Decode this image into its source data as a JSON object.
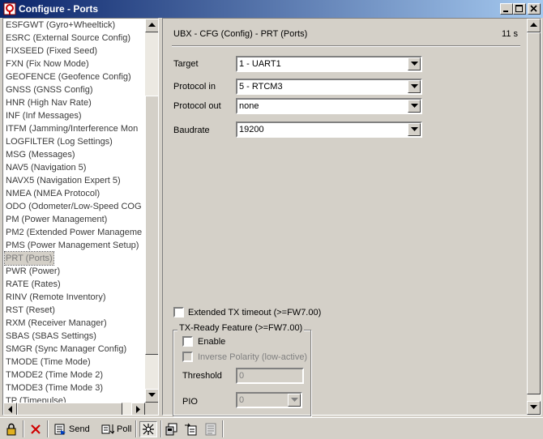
{
  "window": {
    "title": "Configure - Ports"
  },
  "list": {
    "items": [
      "ESFGWT (Gyro+Wheeltick)",
      "ESRC (External Source Config)",
      "FIXSEED (Fixed Seed)",
      "FXN (Fix Now Mode)",
      "GEOFENCE (Geofence Config)",
      "GNSS (GNSS Config)",
      "HNR (High Nav Rate)",
      "INF (Inf Messages)",
      "ITFM (Jamming/Interference Mon",
      "LOGFILTER (Log Settings)",
      "MSG (Messages)",
      "NAV5 (Navigation 5)",
      "NAVX5 (Navigation Expert 5)",
      "NMEA (NMEA Protocol)",
      "ODO (Odometer/Low-Speed COG",
      "PM (Power Management)",
      "PM2 (Extended Power Manageme",
      "PMS (Power Management Setup)",
      "PRT (Ports)",
      "PWR (Power)",
      "RATE (Rates)",
      "RINV (Remote Inventory)",
      "RST (Reset)",
      "RXM (Receiver Manager)",
      "SBAS (SBAS Settings)",
      "SMGR (Sync Manager Config)",
      "TMODE (Time Mode)",
      "TMODE2 (Time Mode 2)",
      "TMODE3 (Time Mode 3)",
      "TP (Timepulse)"
    ],
    "selected_index": 18
  },
  "panel": {
    "title": "UBX - CFG (Config) - PRT (Ports)",
    "time": "11 s",
    "target_label": "Target",
    "target_value": "1 - UART1",
    "protocol_in_label": "Protocol in",
    "protocol_in_value": "5 - RTCM3",
    "protocol_out_label": "Protocol out",
    "protocol_out_value": "none",
    "baudrate_label": "Baudrate",
    "baudrate_value": "19200",
    "extended_tx_label": "Extended TX timeout (>=FW7.00)",
    "txready": {
      "group_label": "TX-Ready Feature (>=FW7.00)",
      "enable_label": "Enable",
      "inverse_label": "Inverse Polarity (low-active)",
      "threshold_label": "Threshold",
      "threshold_value": "0",
      "pio_label": "PIO",
      "pio_value": "0"
    }
  },
  "toolbar": {
    "send_label": "Send",
    "poll_label": "Poll"
  }
}
